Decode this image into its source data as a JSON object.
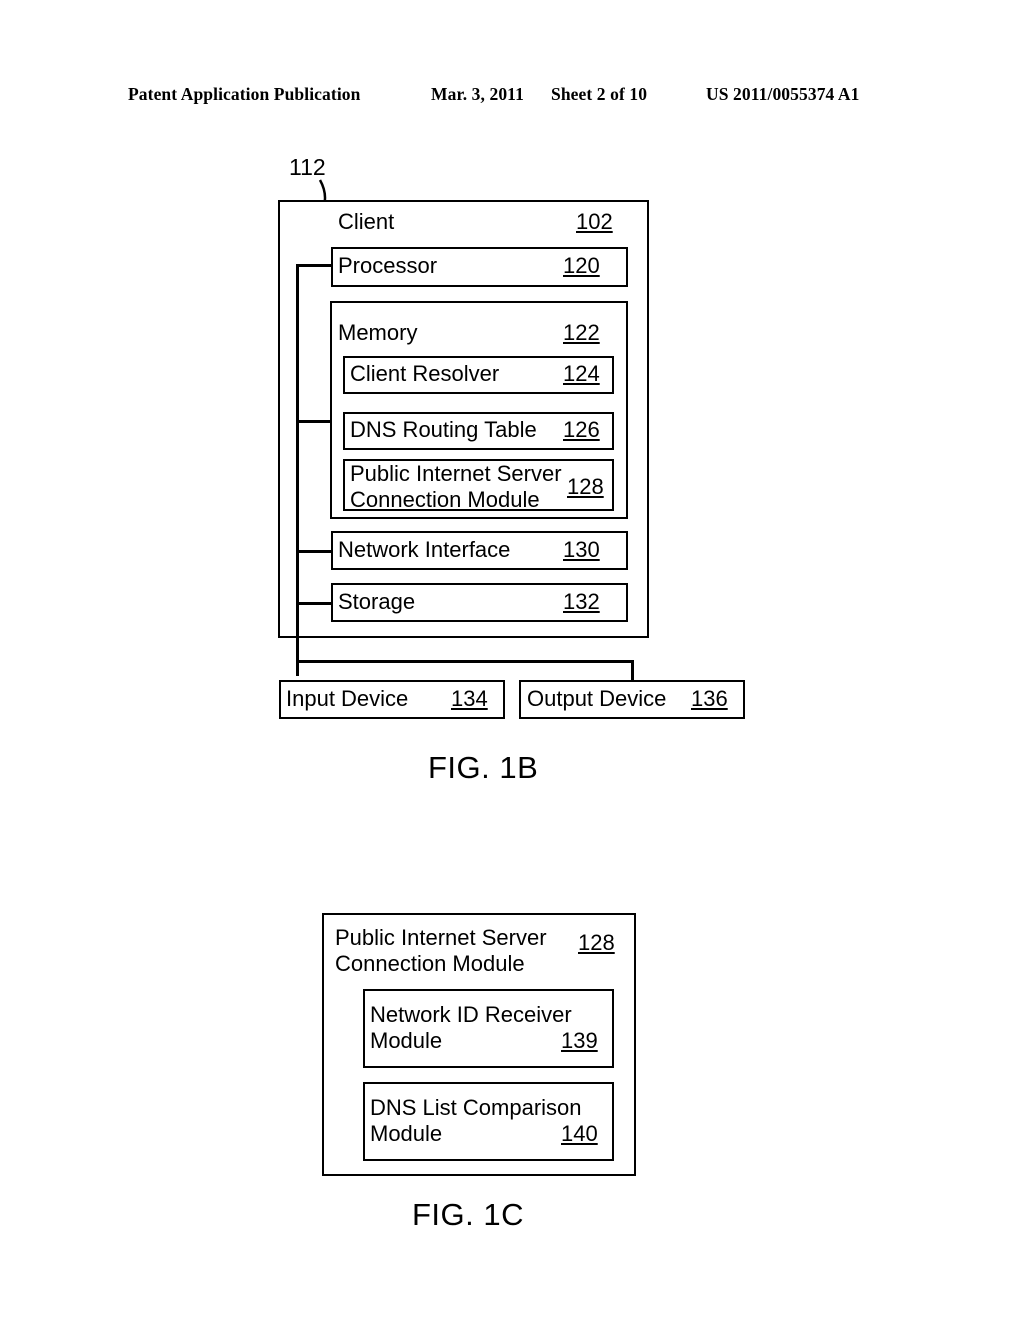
{
  "header": {
    "publication": "Patent Application Publication",
    "date": "Mar. 3, 2011",
    "sheet": "Sheet 2 of 10",
    "patent_number": "US 2011/0055374 A1"
  },
  "fig1b": {
    "caption": "FIG. 1B",
    "bus_tag": "112",
    "client": {
      "label": "Client",
      "ref": "102"
    },
    "processor": {
      "label": "Processor",
      "ref": "120"
    },
    "memory": {
      "label": "Memory",
      "ref": "122",
      "items": [
        {
          "label": "Client Resolver",
          "ref": "124"
        },
        {
          "label": "DNS Routing Table",
          "ref": "126"
        },
        {
          "label": "Public Internet Server\nConnection Module",
          "ref": "128"
        }
      ]
    },
    "network_interface": {
      "label": "Network Interface",
      "ref": "130"
    },
    "storage": {
      "label": "Storage",
      "ref": "132"
    },
    "input_device": {
      "label": "Input Device",
      "ref": "134"
    },
    "output_device": {
      "label": "Output Device",
      "ref": "136"
    }
  },
  "fig1c": {
    "caption": "FIG. 1C",
    "module": {
      "label": "Public Internet Server\nConnection Module",
      "ref": "128"
    },
    "submodules": [
      {
        "label": "Network ID Receiver\nModule",
        "ref": "139"
      },
      {
        "label": "DNS List Comparison\nModule",
        "ref": "140"
      }
    ]
  }
}
